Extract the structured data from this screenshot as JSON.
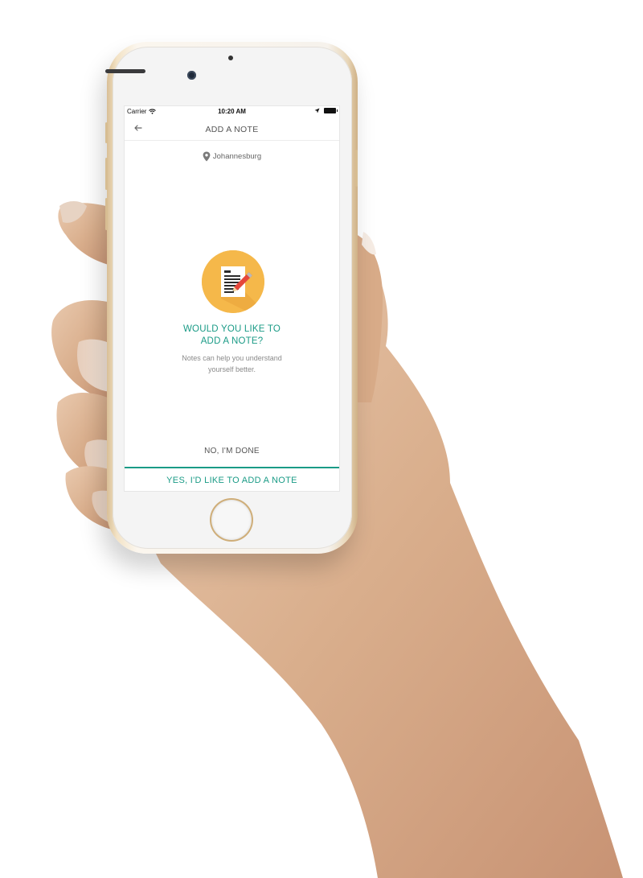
{
  "status_bar": {
    "carrier": "Carrier",
    "time": "10:20 AM"
  },
  "nav": {
    "title": "ADD A NOTE"
  },
  "location": {
    "name": "Johannesburg"
  },
  "prompt": {
    "title_line1": "WOULD YOU LIKE TO",
    "title_line2": "ADD A NOTE?",
    "subtitle_line1": "Notes can help you understand",
    "subtitle_line2": "yourself better."
  },
  "actions": {
    "secondary_label": "NO, I'M DONE",
    "primary_label": "YES, I'D LIKE TO ADD A NOTE"
  },
  "icons": {
    "back": "arrow-left-icon",
    "location": "location-pin-icon",
    "note": "note-pencil-icon",
    "wifi": "wifi-icon",
    "battery": "battery-icon"
  },
  "colors": {
    "accent": "#1a9b86",
    "badge": "#f5b84a"
  }
}
